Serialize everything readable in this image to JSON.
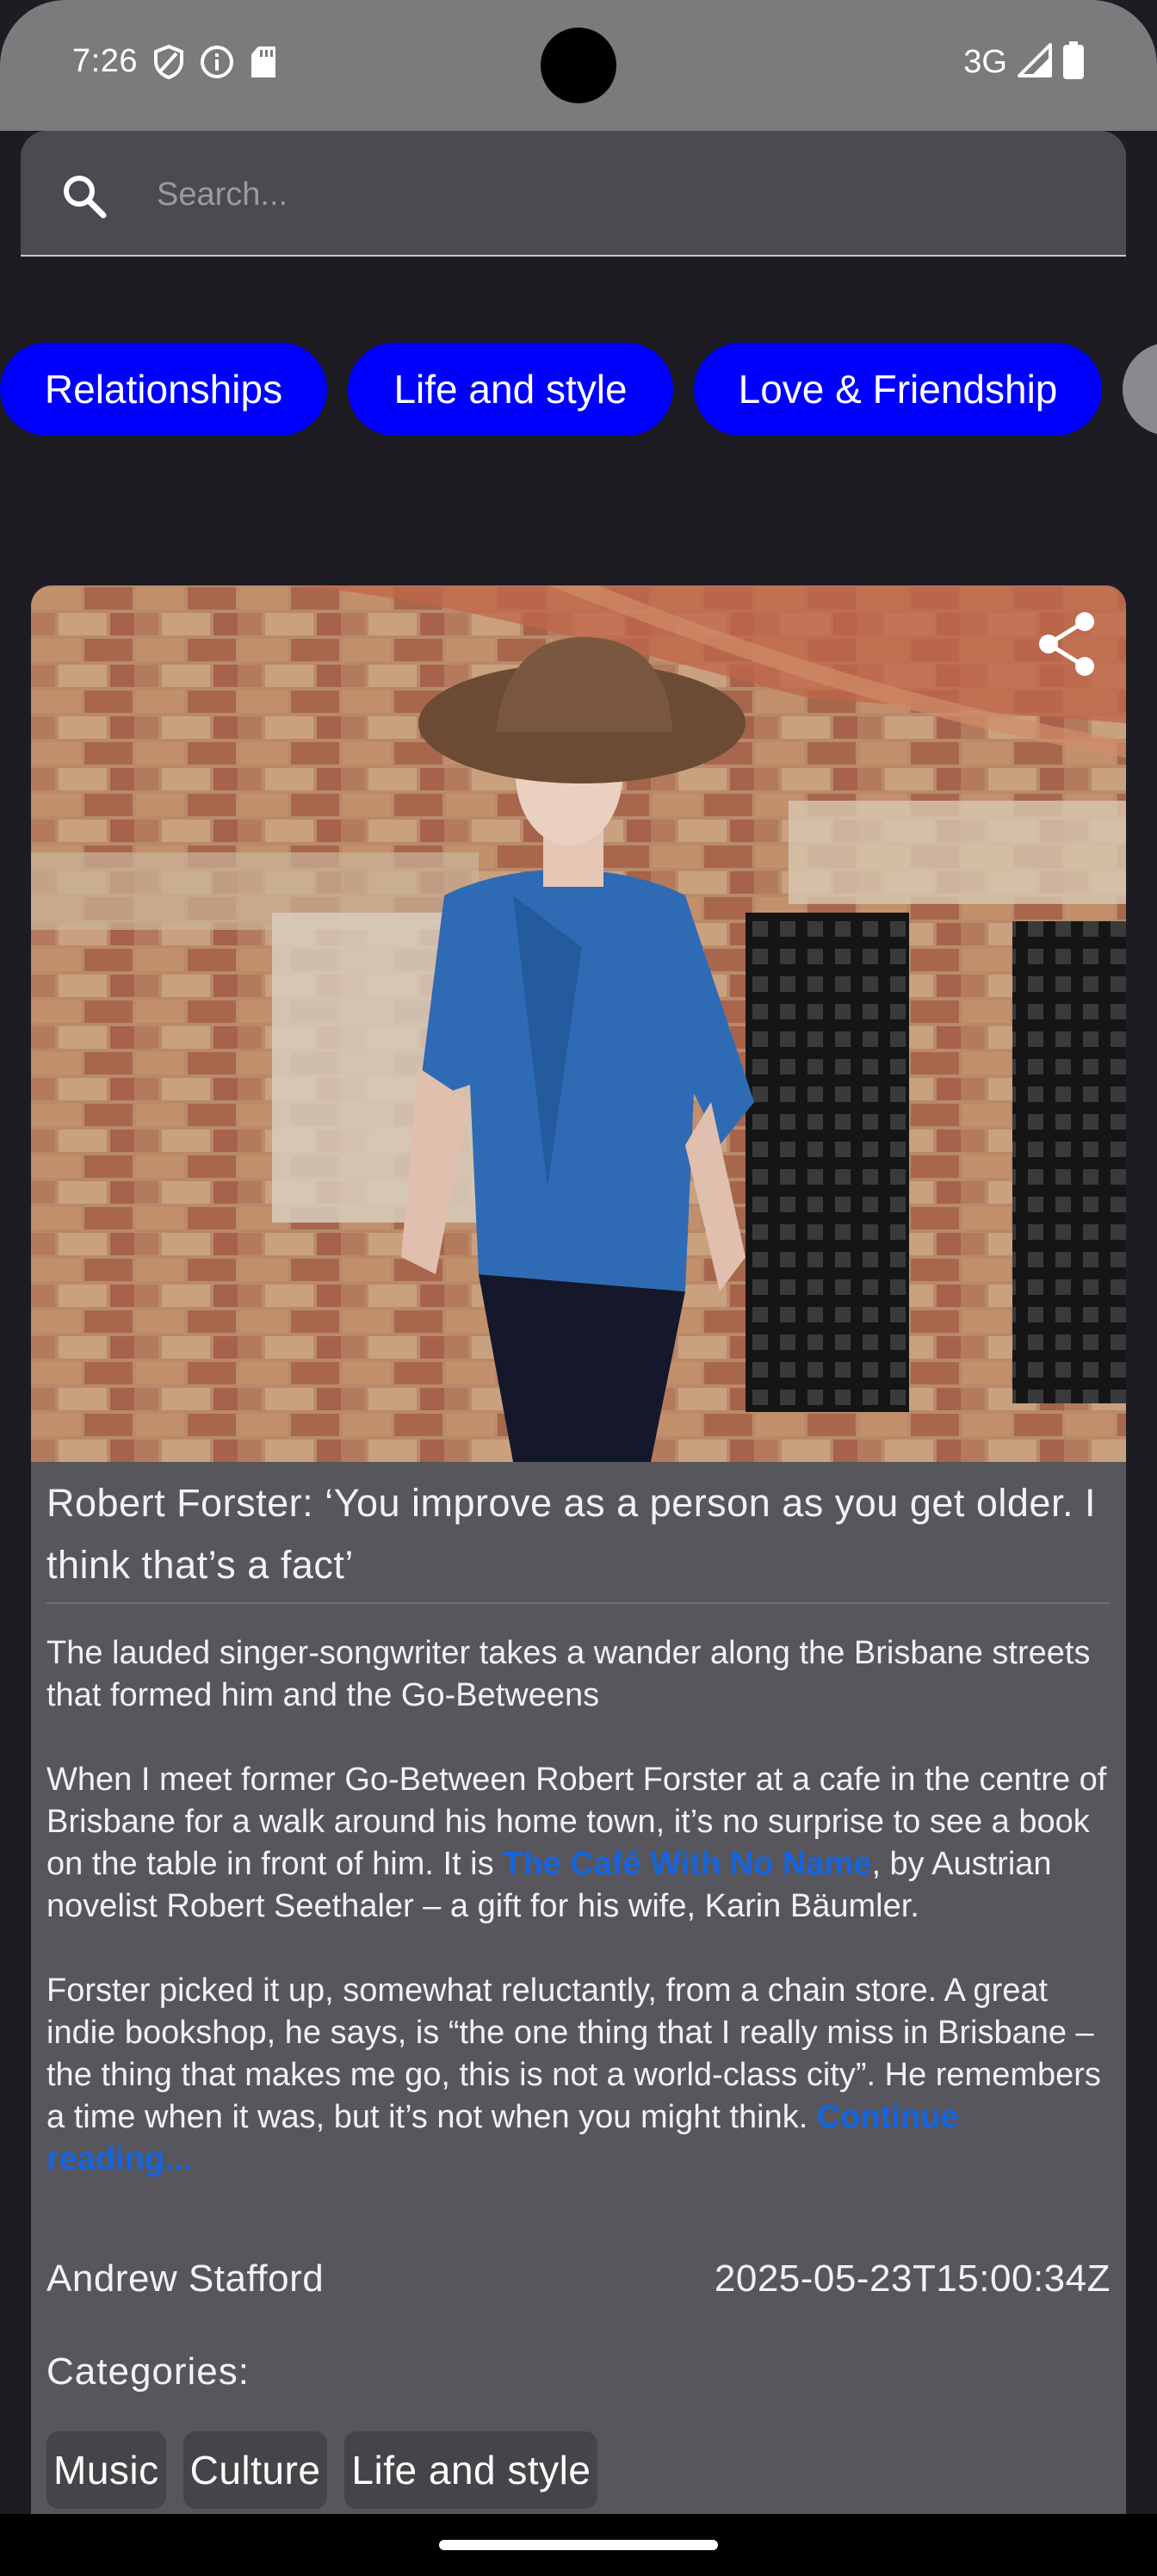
{
  "status_bar": {
    "time": "7:26",
    "network": "3G",
    "icons": [
      "shield-icon",
      "info-icon",
      "sd-card-icon",
      "signal-icon",
      "battery-icon"
    ]
  },
  "search": {
    "placeholder": "Search..."
  },
  "chips": [
    {
      "label": "Relationships"
    },
    {
      "label": "Life and style"
    },
    {
      "label": "Love & Friendship"
    }
  ],
  "article": {
    "title": "Robert Forster: ‘You improve as a person as you get older. I think that’s a fact’",
    "standfirst": "The lauded singer-songwriter takes a wander along the Brisbane streets that formed him and the Go-Betweens",
    "paragraph1_before_link": "When I meet former Go-Between Robert Forster at a cafe in the centre of Brisbane for a walk around his home town, it’s no surprise to see a book on the table in front of him. It is ",
    "paragraph1_link": "The Café With No Name",
    "paragraph1_after_link": ", by Austrian novelist Robert Seethaler – a gift for his wife, Karin Bäumler.",
    "paragraph2": "Forster picked it up, somewhat reluctantly, from a chain store. A great indie bookshop, he says, is “the one thing that I really miss in Brisbane – the thing that makes me go, this is not a world-class city”. He remembers a time when it was, but it’s not when you might think. ",
    "continue_link": "Continue reading...",
    "author": "Andrew Stafford",
    "published": "2025-05-23T15:00:34Z",
    "categories_label": "Categories:",
    "categories": [
      {
        "label": "Music"
      },
      {
        "label": "Culture"
      },
      {
        "label": "Life and style"
      }
    ]
  },
  "colors": {
    "chip_background": "#0000ff",
    "card_background": "#56565c",
    "link": "#1565e0",
    "page_background": "#1c1c22"
  }
}
